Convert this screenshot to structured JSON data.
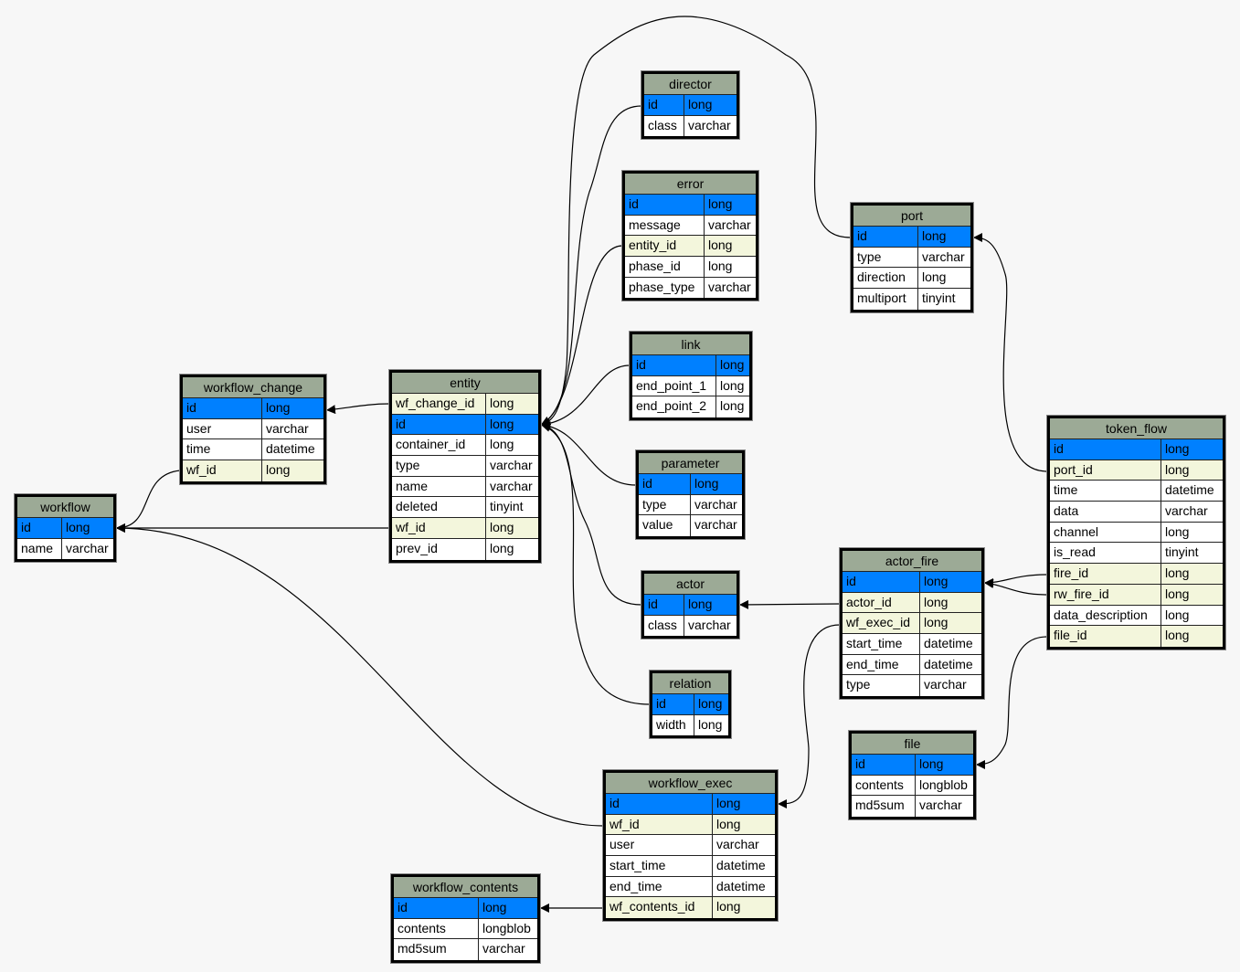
{
  "colors": {
    "background": "#f7f7f7",
    "header": "#9caa96",
    "primary_key": "#0080ff",
    "foreign_key": "#f3f6dc",
    "plain": "#ffffff",
    "edge": "#000000"
  },
  "tables": [
    {
      "name": "workflow",
      "rows": [
        [
          "id",
          "long",
          "pk"
        ],
        [
          "name",
          "varchar",
          ""
        ]
      ]
    },
    {
      "name": "workflow_change",
      "rows": [
        [
          "id",
          "long",
          "pk"
        ],
        [
          "user",
          "varchar",
          ""
        ],
        [
          "time",
          "datetime",
          ""
        ],
        [
          "wf_id",
          "long",
          "fk"
        ]
      ]
    },
    {
      "name": "entity",
      "rows": [
        [
          "wf_change_id",
          "long",
          "fk"
        ],
        [
          "id",
          "long",
          "pk"
        ],
        [
          "container_id",
          "long",
          ""
        ],
        [
          "type",
          "varchar",
          ""
        ],
        [
          "name",
          "varchar",
          ""
        ],
        [
          "deleted",
          "tinyint",
          ""
        ],
        [
          "wf_id",
          "long",
          "fk"
        ],
        [
          "prev_id",
          "long",
          ""
        ]
      ]
    },
    {
      "name": "director",
      "rows": [
        [
          "id",
          "long",
          "pk"
        ],
        [
          "class",
          "varchar",
          ""
        ]
      ]
    },
    {
      "name": "error",
      "rows": [
        [
          "id",
          "long",
          "pk"
        ],
        [
          "message",
          "varchar",
          ""
        ],
        [
          "entity_id",
          "long",
          "fk"
        ],
        [
          "phase_id",
          "long",
          ""
        ],
        [
          "phase_type",
          "varchar",
          ""
        ]
      ]
    },
    {
      "name": "link",
      "rows": [
        [
          "id",
          "long",
          "pk"
        ],
        [
          "end_point_1",
          "long",
          ""
        ],
        [
          "end_point_2",
          "long",
          ""
        ]
      ]
    },
    {
      "name": "parameter",
      "rows": [
        [
          "id",
          "long",
          "pk"
        ],
        [
          "type",
          "varchar",
          ""
        ],
        [
          "value",
          "varchar",
          ""
        ]
      ]
    },
    {
      "name": "actor",
      "rows": [
        [
          "id",
          "long",
          "pk"
        ],
        [
          "class",
          "varchar",
          ""
        ]
      ]
    },
    {
      "name": "relation",
      "rows": [
        [
          "id",
          "long",
          "pk"
        ],
        [
          "width",
          "long",
          ""
        ]
      ]
    },
    {
      "name": "port",
      "rows": [
        [
          "id",
          "long",
          "pk"
        ],
        [
          "type",
          "varchar",
          ""
        ],
        [
          "direction",
          "long",
          ""
        ],
        [
          "multiport",
          "tinyint",
          ""
        ]
      ]
    },
    {
      "name": "token_flow",
      "rows": [
        [
          "id",
          "long",
          "pk"
        ],
        [
          "port_id",
          "long",
          "fk"
        ],
        [
          "time",
          "datetime",
          ""
        ],
        [
          "data",
          "varchar",
          ""
        ],
        [
          "channel",
          "long",
          ""
        ],
        [
          "is_read",
          "tinyint",
          ""
        ],
        [
          "fire_id",
          "long",
          "fk"
        ],
        [
          "rw_fire_id",
          "long",
          "fk"
        ],
        [
          "data_description",
          "long",
          ""
        ],
        [
          "file_id",
          "long",
          "fk"
        ]
      ]
    },
    {
      "name": "actor_fire",
      "rows": [
        [
          "id",
          "long",
          "pk"
        ],
        [
          "actor_id",
          "long",
          "fk"
        ],
        [
          "wf_exec_id",
          "long",
          "fk"
        ],
        [
          "start_time",
          "datetime",
          ""
        ],
        [
          "end_time",
          "datetime",
          ""
        ],
        [
          "type",
          "varchar",
          ""
        ]
      ]
    },
    {
      "name": "file",
      "rows": [
        [
          "id",
          "long",
          "pk"
        ],
        [
          "contents",
          "longblob",
          ""
        ],
        [
          "md5sum",
          "varchar",
          ""
        ]
      ]
    },
    {
      "name": "workflow_exec",
      "rows": [
        [
          "id",
          "long",
          "pk"
        ],
        [
          "wf_id",
          "long",
          "fk"
        ],
        [
          "user",
          "varchar",
          ""
        ],
        [
          "start_time",
          "datetime",
          ""
        ],
        [
          "end_time",
          "datetime",
          ""
        ],
        [
          "wf_contents_id",
          "long",
          "fk"
        ]
      ]
    },
    {
      "name": "workflow_contents",
      "rows": [
        [
          "id",
          "long",
          "pk"
        ],
        [
          "contents",
          "longblob",
          ""
        ],
        [
          "md5sum",
          "varchar",
          ""
        ]
      ]
    }
  ],
  "relations": [
    [
      "entity.wf_change_id",
      "workflow_change.id"
    ],
    [
      "workflow_change.wf_id",
      "workflow.id"
    ],
    [
      "entity.wf_id",
      "workflow.id"
    ],
    [
      "workflow_exec.wf_id",
      "workflow.id"
    ],
    [
      "director.id",
      "entity.id"
    ],
    [
      "error.entity_id",
      "entity.id"
    ],
    [
      "link.id",
      "entity.id"
    ],
    [
      "parameter.id",
      "entity.id"
    ],
    [
      "actor.id",
      "entity.id"
    ],
    [
      "relation.id",
      "entity.id"
    ],
    [
      "port.id",
      "entity.id"
    ],
    [
      "token_flow.port_id",
      "port.id"
    ],
    [
      "actor_fire.actor_id",
      "actor.id"
    ],
    [
      "actor_fire.wf_exec_id",
      "workflow_exec.id"
    ],
    [
      "token_flow.fire_id",
      "actor_fire.id"
    ],
    [
      "token_flow.rw_fire_id",
      "actor_fire.id"
    ],
    [
      "token_flow.file_id",
      "file.id"
    ],
    [
      "workflow_exec.wf_contents_id",
      "workflow_contents.id"
    ]
  ]
}
